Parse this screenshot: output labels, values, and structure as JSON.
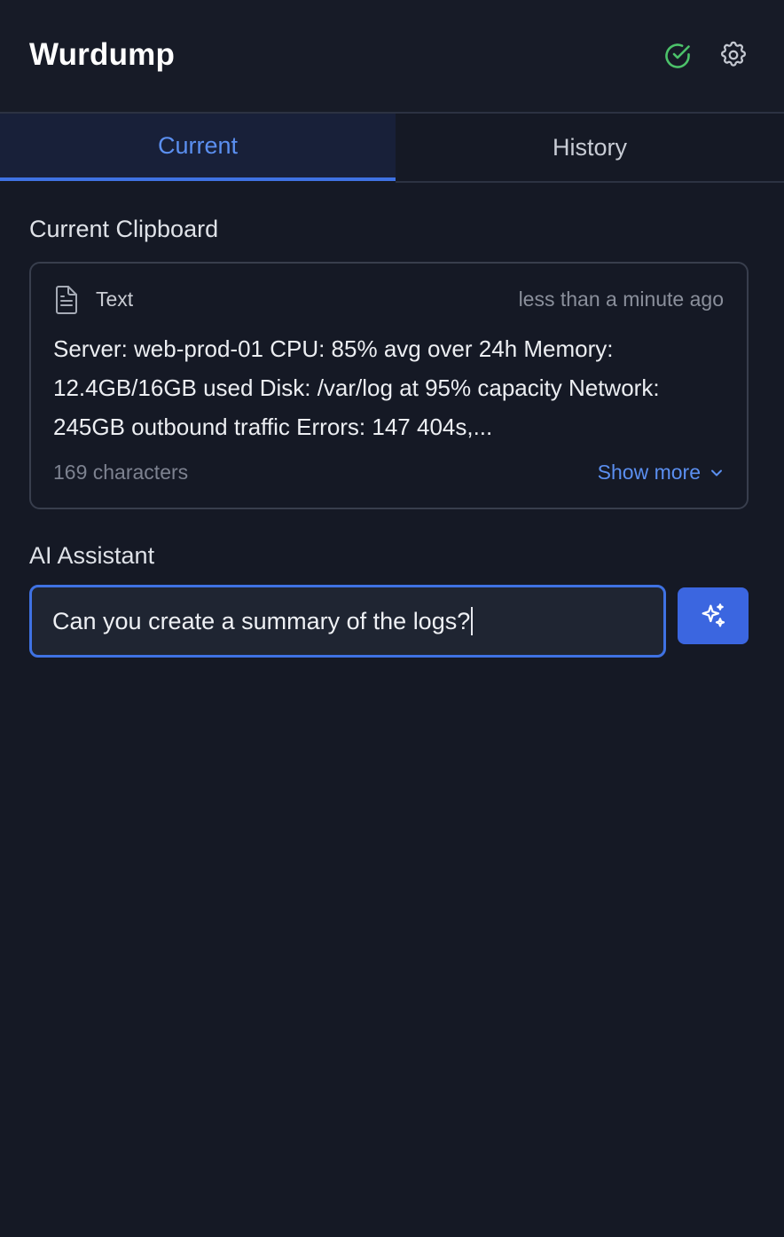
{
  "app": {
    "title": "Wurdump"
  },
  "header": {
    "status_icon": "check-circle-icon",
    "settings_icon": "gear-icon"
  },
  "tabs": [
    {
      "label": "Current",
      "active": true
    },
    {
      "label": "History",
      "active": false
    }
  ],
  "clipboard": {
    "section_title": "Current Clipboard",
    "type_icon": "document-icon",
    "type_label": "Text",
    "timestamp": "less than a minute ago",
    "content": "Server: web-prod-01 CPU: 85% avg over 24h Memory: 12.4GB/16GB used Disk: /var/log at 95% capacity Network: 245GB outbound traffic Errors: 147 404s,...",
    "char_count": "169 characters",
    "show_more_label": "Show more"
  },
  "ai": {
    "section_title": "AI Assistant",
    "input_value": "Can you create a summary of the logs?",
    "send_icon": "sparkles-icon"
  },
  "colors": {
    "background": "#151925",
    "accent": "#3f72e3",
    "accent_text": "#5b8ff0",
    "success": "#4cc26a"
  }
}
